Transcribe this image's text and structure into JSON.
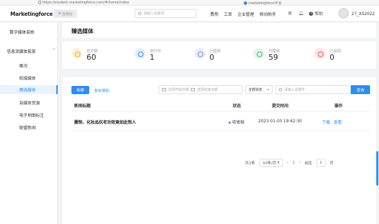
{
  "browser": {
    "url": "https://student.marketingforce.com/#/home/index",
    "tab_title": "marketingforce平台"
  },
  "topbar": {
    "logo": "Marketingforce",
    "console_button": "控制台",
    "search_placeholder": "请输入关键词",
    "menu": [
      "费用",
      "工单",
      "企业管理",
      "移动助手"
    ],
    "help": "帮助",
    "username": "27_XS2022"
  },
  "sidebar": {
    "section_top": "数字媒体自助",
    "section_group": "信息流媒体投放",
    "items": [
      {
        "label": "概况"
      },
      {
        "label": "权威媒体"
      },
      {
        "label": "臻选媒体"
      },
      {
        "label": "自媒体资源"
      },
      {
        "label": "电子地图标注"
      },
      {
        "label": "联盟新闻"
      }
    ]
  },
  "page": {
    "title": "臻选媒体"
  },
  "stats": [
    {
      "label": "总文数",
      "value": "60",
      "color": "#f5a623",
      "bg": "#fdf1dd"
    },
    {
      "label": "进行中",
      "value": "1",
      "color": "#2d8cf0",
      "bg": "#e3f0fd"
    },
    {
      "label": "已使用",
      "value": "0",
      "color": "#7a8dd6",
      "bg": "#e9ecf8"
    },
    {
      "label": "可使用",
      "value": "59",
      "color": "#3cb878",
      "bg": "#e2f5ea"
    },
    {
      "label": "已驳回",
      "value": "0",
      "color": "#e85a5a",
      "bg": "#fbe4e4"
    }
  ],
  "toolbar": {
    "new_button": "新建",
    "guide_link": "发布须知",
    "start_date_placeholder": "选择开始日期",
    "end_date_placeholder": "选择结束日期",
    "status_select": "全部状态",
    "keyword_placeholder": "请输入关键字",
    "search_button": "查询"
  },
  "table": {
    "columns": [
      "新闻标题",
      "状态",
      "提交时间",
      "操作"
    ],
    "rows": [
      {
        "title": "震惊、化妆品抗老功效竟如此惊人",
        "status": "待审核",
        "time": "2023-01-03 19:42:30",
        "op1": "下载",
        "op2": "查看"
      }
    ]
  },
  "pagination": {
    "total": "共1条",
    "page_size": "10条/页",
    "current": "1",
    "goto_label": "前往",
    "goto_value": "1",
    "page_suffix": "页"
  }
}
